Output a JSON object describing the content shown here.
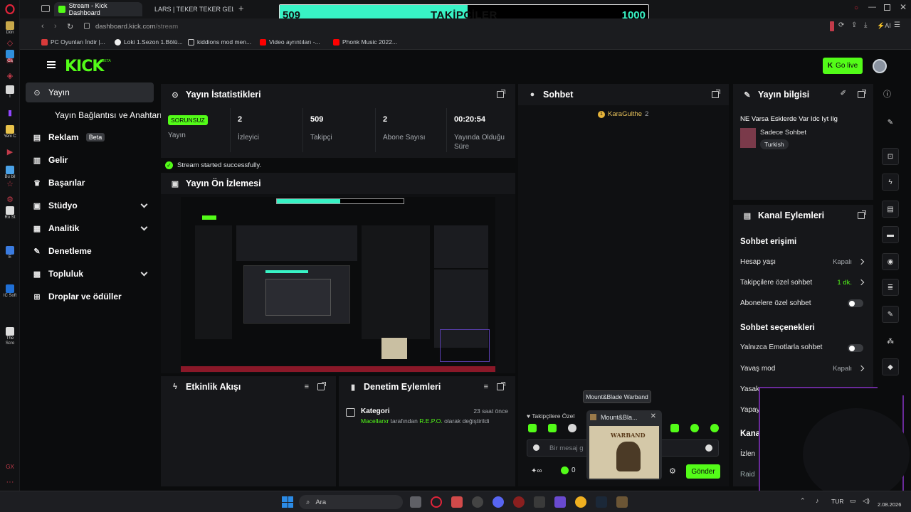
{
  "browser": {
    "tabs": [
      {
        "label": "Stream - Kick Dashboard",
        "active": true
      },
      {
        "label": "LARS | TEKER TEKER GELİ",
        "active": false
      }
    ],
    "url_host": "dashboard.kick.com",
    "url_path": "/stream",
    "bookmarks": [
      "PC Oyunları İndir |...",
      "Loki 1.Sezon 1.Bölü...",
      "kiddions mod men...",
      "Video ayrıntıları -...",
      "Phonk Music 2022..."
    ],
    "ai_label": "AI"
  },
  "desktop_icons": [
    "Dön",
    "Ca",
    "I",
    "Yeni C",
    "Bu bil",
    "Ro St",
    "E",
    "IC Soft",
    "The Scro"
  ],
  "goal_overlay": {
    "current": "509",
    "label": "TAKİPÇİLER",
    "target": "1000",
    "progress": 0.509
  },
  "header": {
    "logo": "KICK",
    "logo_badge": "BETA",
    "go_live": "Go live"
  },
  "nav": {
    "items": [
      {
        "label": "Yayın",
        "icon": "broadcast-icon",
        "selected": true
      },
      {
        "label": "Yayın Bağlantısı ve Anahtarı",
        "icon": ""
      },
      {
        "label": "Reklam",
        "icon": "ad-icon",
        "badge": "Beta"
      },
      {
        "label": "Gelir",
        "icon": "chart-icon"
      },
      {
        "label": "Başarılar",
        "icon": "trophy-icon"
      },
      {
        "label": "Stüdyo",
        "icon": "studio-icon",
        "expand": true
      },
      {
        "label": "Analitik",
        "icon": "analytics-icon",
        "expand": true
      },
      {
        "label": "Denetleme",
        "icon": "wrench-icon"
      },
      {
        "label": "Topluluk",
        "icon": "community-icon",
        "expand": true
      },
      {
        "label": "Droplar ve ödüller",
        "icon": "gift-icon"
      }
    ]
  },
  "stats": {
    "title": "Yayın İstatistikleri",
    "stream_status": "SORUNSUZ",
    "stream_label": "Yayın",
    "viewers": "2",
    "viewers_label": "İzleyici",
    "followers": "509",
    "followers_label": "Takipçi",
    "subs": "2",
    "subs_label": "Abone Sayısı",
    "uptime": "00:20:54",
    "uptime_label": "Yayında Olduğu Süre",
    "toast": "Stream started successfully."
  },
  "preview": {
    "title": "Yayın Ön İzlemesi"
  },
  "activity": {
    "title": "Etkinlik Akışı"
  },
  "modlog": {
    "title": "Denetim Eylemleri",
    "entry_title": "Kategori",
    "entry_time": "23 saat önce",
    "entry_user": "Macellarxr",
    "entry_mid": "tarafından",
    "entry_value": "R.E.P.O.",
    "entry_end": "olarak değiştirildi"
  },
  "chat": {
    "title": "Sohbet",
    "viewer_name": "KaraGulthe",
    "viewer_count": "2",
    "follower_only": "Takipçilere Özel",
    "input_placeholder": "Bir mesaj g",
    "points": "0",
    "send": "Gönder"
  },
  "tooltip": {
    "label": "Mount&Blade Warband",
    "card_title": "Mount&Bla...",
    "card_art": "WARBAND"
  },
  "stream_info": {
    "title": "Yayın bilgisi",
    "stream_title": "NE Varsa Esklerde Var Idc Iyt Ilg",
    "category": "Sadece Sohbet",
    "language": "Turkish"
  },
  "channel_actions": {
    "title": "Kanal Eylemleri",
    "chat_access": "Sohbet erişimi",
    "account_age": "Hesap yaşı",
    "account_age_val": "Kapalı",
    "follower_chat": "Takipçilere özel sohbet",
    "follower_chat_val": "1 dk.",
    "sub_chat": "Abonelere özel sohbet",
    "chat_options": "Sohbet seçenekleri",
    "emote_only": "Yalnızca Emotlarla sohbet",
    "slow_mode": "Yavaş mod",
    "slow_mode_val": "Kapalı",
    "cut1": "Yasak",
    "cut2": "Yapay",
    "cut3": "Kana",
    "cut4": "İzlen",
    "cut5": "Raid"
  },
  "taskbar": {
    "search": "Ara",
    "lang": "TUR",
    "date": "2.08.2026"
  },
  "colors": {
    "kick_green": "#53fc18",
    "goal_teal": "#38f3c5",
    "panel": "#16171a",
    "bg": "#0b0c0d",
    "opera_red": "#c23b4a"
  }
}
